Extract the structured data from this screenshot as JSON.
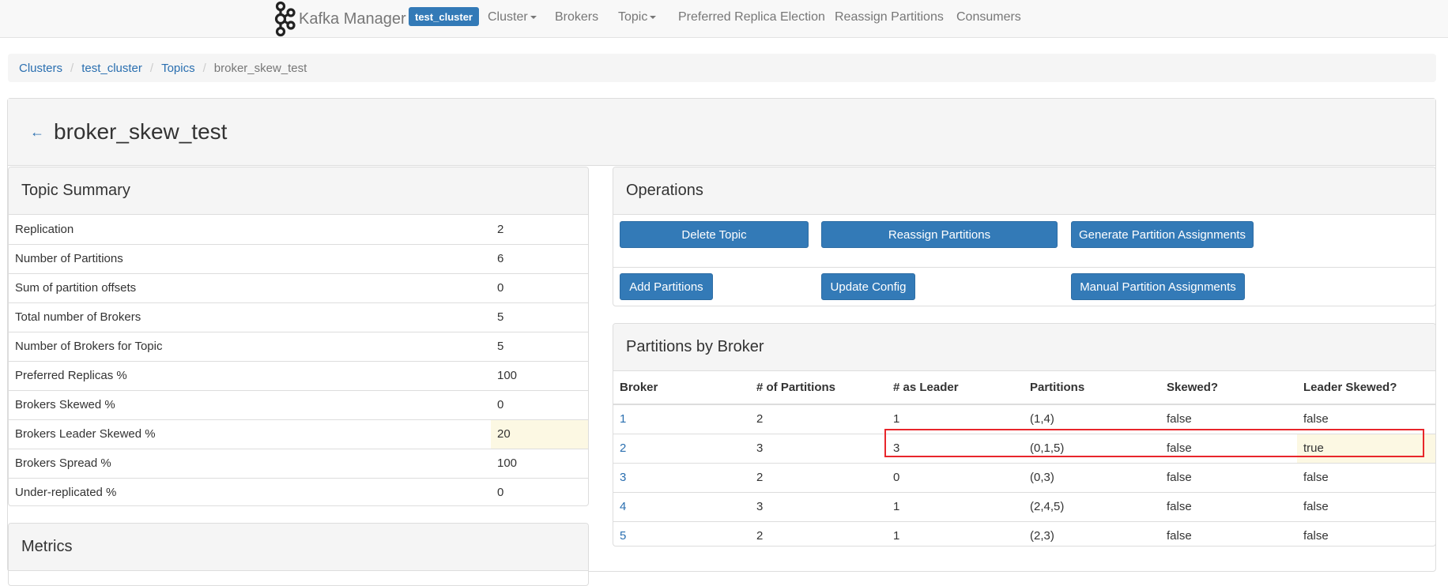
{
  "navbar": {
    "brand": "Kafka Manager",
    "cluster_badge": "test_cluster",
    "items": {
      "cluster": "Cluster",
      "brokers": "Brokers",
      "topic": "Topic",
      "preferred": "Preferred Replica Election",
      "reassign": "Reassign Partitions",
      "consumers": "Consumers"
    }
  },
  "breadcrumb": {
    "clusters": "Clusters",
    "cluster": "test_cluster",
    "topics": "Topics",
    "current": "broker_skew_test",
    "separator": "/"
  },
  "page": {
    "title": "broker_skew_test",
    "back_icon": "←"
  },
  "summary": {
    "title": "Topic Summary",
    "rows": [
      {
        "label": "Replication",
        "value": "2"
      },
      {
        "label": "Number of Partitions",
        "value": "6"
      },
      {
        "label": "Sum of partition offsets",
        "value": "0"
      },
      {
        "label": "Total number of Brokers",
        "value": "5"
      },
      {
        "label": "Number of Brokers for Topic",
        "value": "5"
      },
      {
        "label": "Preferred Replicas %",
        "value": "100"
      },
      {
        "label": "Brokers Skewed %",
        "value": "0"
      },
      {
        "label": "Brokers Leader Skewed %",
        "value": "20"
      },
      {
        "label": "Brokers Spread %",
        "value": "100"
      },
      {
        "label": "Under-replicated %",
        "value": "0"
      }
    ]
  },
  "metrics": {
    "title": "Metrics"
  },
  "operations": {
    "title": "Operations",
    "delete_topic": "Delete Topic",
    "reassign_partitions": "Reassign Partitions",
    "generate_assignments": "Generate Partition Assignments",
    "add_partitions": "Add Partitions",
    "update_config": "Update Config",
    "manual_assignments": "Manual Partition Assignments"
  },
  "partitions_by_broker": {
    "title": "Partitions by Broker",
    "columns": [
      "Broker",
      "# of Partitions",
      "# as Leader",
      "Partitions",
      "Skewed?",
      "Leader Skewed?"
    ],
    "rows": [
      {
        "broker": "1",
        "num_partitions": "2",
        "as_leader": "1",
        "partitions": "(1,4)",
        "skewed": "false",
        "leader_skewed": "false"
      },
      {
        "broker": "2",
        "num_partitions": "3",
        "as_leader": "3",
        "partitions": "(0,1,5)",
        "skewed": "false",
        "leader_skewed": "true"
      },
      {
        "broker": "3",
        "num_partitions": "2",
        "as_leader": "0",
        "partitions": "(0,3)",
        "skewed": "false",
        "leader_skewed": "false"
      },
      {
        "broker": "4",
        "num_partitions": "3",
        "as_leader": "1",
        "partitions": "(2,4,5)",
        "skewed": "false",
        "leader_skewed": "false"
      },
      {
        "broker": "5",
        "num_partitions": "2",
        "as_leader": "1",
        "partitions": "(2,3)",
        "skewed": "false",
        "leader_skewed": "false"
      }
    ]
  },
  "colors": {
    "primary": "#337ab7",
    "link": "#2a6fb0",
    "warning_bg": "#fcf8e3",
    "highlight_border": "#e8262b"
  }
}
